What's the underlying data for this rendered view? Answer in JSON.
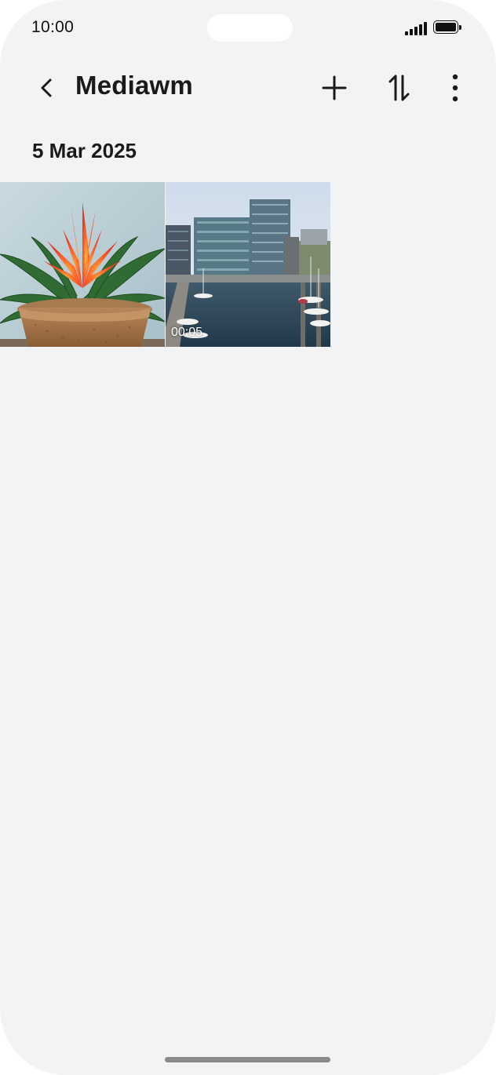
{
  "status_bar": {
    "time": "10:00"
  },
  "app_bar": {
    "title": "Mediawm",
    "back_icon": "chevron-left-icon",
    "add_icon": "plus-icon",
    "sort_icon": "sort-icon",
    "more_icon": "more-vertical-icon"
  },
  "gallery": {
    "date": "5 Mar 2025",
    "items": [
      {
        "type": "photo",
        "subject": "potted bromeliad plant"
      },
      {
        "type": "video",
        "subject": "harbor marina with office buildings",
        "duration": "00:05"
      }
    ]
  },
  "colors": {
    "background": "#f2f3f5",
    "text": "#1a1a1a"
  }
}
